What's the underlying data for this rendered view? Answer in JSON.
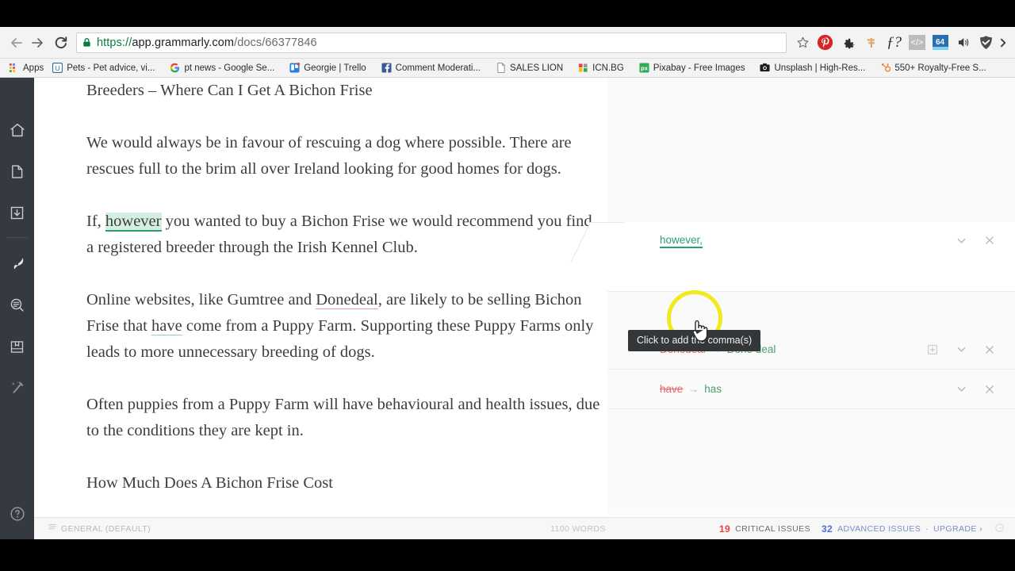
{
  "browser": {
    "nav": {
      "back_label": "Back",
      "forward_label": "Forward",
      "reload_label": "Reload"
    },
    "url": {
      "scheme": "https://",
      "host": "app.grammarly.com",
      "path": "/docs/66377846",
      "secure_label": "Secure"
    },
    "extensions": [
      {
        "name": "bookmark-star-icon",
        "label": "☆"
      },
      {
        "name": "pinterest-icon",
        "label": "P"
      },
      {
        "name": "gear-icon",
        "label": "⚙"
      },
      {
        "name": "signpost-icon",
        "label": "⌐"
      },
      {
        "name": "fonts-ninja-icon",
        "label": "ƒ?"
      },
      {
        "name": "code-icon",
        "label": "</>"
      },
      {
        "name": "sixtyfour-icon",
        "label": "64"
      },
      {
        "name": "mute-tab-icon",
        "label": "◀"
      },
      {
        "name": "shield-icon",
        "label": "▼"
      },
      {
        "name": "menu-overflow-icon",
        "label": "▸"
      }
    ],
    "bookmarks": [
      {
        "label": "Apps",
        "icon": "apps-grid-icon"
      },
      {
        "label": "Pets - Pet advice, vi...",
        "icon": "u-square-icon"
      },
      {
        "label": "pt news - Google Se...",
        "icon": "google-g-icon"
      },
      {
        "label": "Georgie | Trello",
        "icon": "trello-icon"
      },
      {
        "label": "Comment Moderati...",
        "icon": "facebook-icon"
      },
      {
        "label": "SALES LION",
        "icon": "page-icon"
      },
      {
        "label": "ICN.BG",
        "icon": "icn-squares-icon"
      },
      {
        "label": "Pixabay - Free Images",
        "icon": "pixabay-icon"
      },
      {
        "label": "Unsplash | High-Res...",
        "icon": "camera-icon"
      },
      {
        "label": "550+ Royalty-Free S...",
        "icon": "hubspot-icon"
      }
    ]
  },
  "rail": {
    "items": [
      {
        "name": "home-icon",
        "label": "Home"
      },
      {
        "name": "document-icon",
        "label": "New document"
      },
      {
        "name": "download-icon",
        "label": "Download"
      },
      {
        "name": "pen-nib-icon",
        "label": "Assistant"
      },
      {
        "name": "text-search-icon",
        "label": "Review"
      },
      {
        "name": "handbook-icon",
        "label": "Handbook"
      },
      {
        "name": "magic-wand-icon",
        "label": "Plagiarism"
      }
    ],
    "help_label": "?"
  },
  "document": {
    "heading": "Breeders – Where Can I Get A Bichon Frise",
    "paragraphs": [
      {
        "id": "p1",
        "text": "We would always be in favour of rescuing a dog where possible. There are rescues full to the brim all over Ireland looking for good homes for dogs."
      },
      {
        "id": "p2",
        "pre": "If, ",
        "highlight": "however",
        "post": " you wanted to buy a Bichon Frise we would recommend you find a registered breeder through the Irish Kennel Club."
      },
      {
        "id": "p3",
        "a": "Online websites, like Gumtree and ",
        "err1": "Donedeal",
        "b": ", are likely to be selling Bichon Frise that ",
        "err2": "have",
        "c": " come from a Puppy Farm. Supporting these Puppy Farms only leads to more unnecessary breeding of dogs."
      },
      {
        "id": "p4",
        "text": "Often puppies from a Puppy Farm will have behavioural and health issues, due to the conditions they are kept in."
      }
    ],
    "next_heading": "How Much Does A Bichon Frise Cost"
  },
  "suggestions": {
    "tooltip": "Click to add the comma(s)",
    "cards": [
      {
        "id": "comma-card",
        "active": true,
        "replacement": "however",
        "comma": ",",
        "has_dictionary_button": false,
        "expand_label": "⌄",
        "dismiss_label": "✕"
      },
      {
        "id": "donedeal-card",
        "active": false,
        "original": "Donedeal",
        "arrow": "→",
        "replacement": "Done deal",
        "has_dictionary_button": true,
        "dictionary_label": "⊞",
        "expand_label": "⌄",
        "dismiss_label": "✕"
      },
      {
        "id": "have-card",
        "active": false,
        "original": "have",
        "arrow": "→",
        "replacement": "has",
        "has_dictionary_button": false,
        "expand_label": "⌄",
        "dismiss_label": "✕"
      }
    ]
  },
  "statusbar": {
    "goal_label": "GENERAL (DEFAULT)",
    "word_count": "1100 WORDS",
    "critical_count": "19",
    "critical_label": "CRITICAL ISSUES",
    "advanced_count": "32",
    "advanced_label": "ADVANCED ISSUES",
    "separator": "·",
    "upgrade_label": "UPGRADE ›"
  },
  "colors": {
    "rail_bg": "#353a40",
    "accent_green": "#2e9e6e",
    "error_red": "#e26a6a",
    "critical_red": "#e8433f",
    "advanced_blue": "#4a6fd4",
    "highlight_ring": "#f2ea1c",
    "tooltip_bg": "#333739"
  }
}
